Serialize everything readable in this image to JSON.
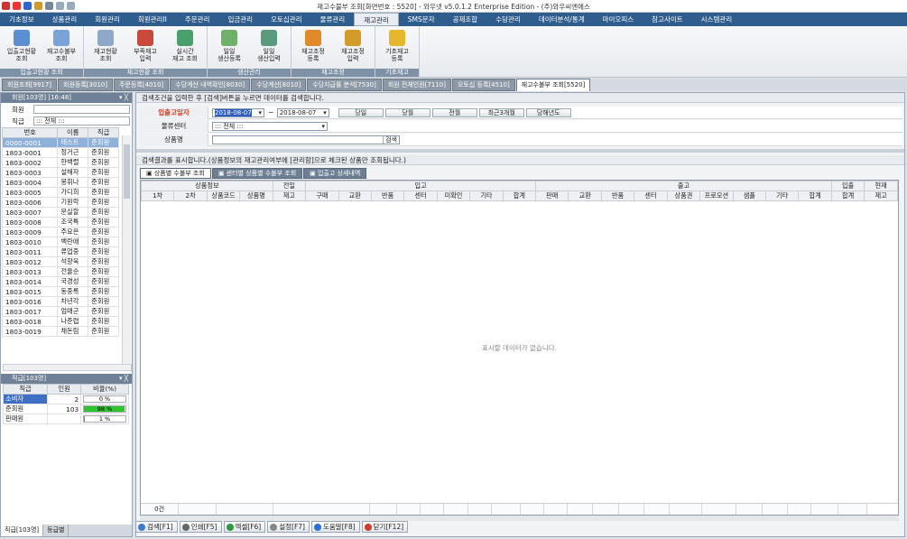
{
  "title": "재고수불부 조회[화면번호 : 5520] - 와우넷 v5.0.1.2 Enterprise Edition - (주)와우씨엔에스",
  "menu": [
    "기초정보",
    "상품관리",
    "회원관리",
    "회원관리II",
    "주문관리",
    "입금관리",
    "오토십관리",
    "물류관리",
    "재고관리",
    "SMS문자",
    "공제조합",
    "수당관리",
    "데이터분석/통계",
    "마이오피스",
    "참고사이트",
    "시스템관리"
  ],
  "active_menu": "재고관리",
  "ribbon_groups": [
    {
      "label": "입출고현황 조회",
      "buttons": [
        "입출고현황\n조회",
        "재고수불부\n조회"
      ]
    },
    {
      "label": "재고현황 조회",
      "buttons": [
        "재고현황\n조회",
        "부족재고\n입력",
        "실시간\n재고 조회"
      ]
    },
    {
      "label": "생산관리",
      "buttons": [
        "일일\n생산등록",
        "일일\n생산입력"
      ]
    },
    {
      "label": "재고조정",
      "buttons": [
        "재고조정\n등록",
        "재고조정\n입력"
      ]
    },
    {
      "label": "기초재고",
      "buttons": [
        "기초재고\n등록"
      ]
    }
  ],
  "doc_tabs": [
    "회원조회[9917]",
    "회원등록[3010]",
    "주문등록[4010]",
    "수당계산 내역확인[8030]",
    "수당계산[8010]",
    "수당지급률 분석[7530]",
    "회원 전체인원[7110]",
    "오토십 등록[4510]",
    "재고수불부 조회[5520]"
  ],
  "active_doc_tab": "재고수불부 조회[5520]",
  "left": {
    "title": "회원[103명] [16:48]",
    "filter_name_label": "회원",
    "filter_name_value": "",
    "filter_rank_label": "직급",
    "filter_rank_value": "::: 전체 :::",
    "headers": [
      "번호",
      "이름",
      "직급"
    ],
    "rows": [
      [
        "0000-0001",
        "테스트",
        "준회원"
      ],
      [
        "1803-0001",
        "정거근",
        "준회원"
      ],
      [
        "1803-0002",
        "한백렬",
        "준회원"
      ],
      [
        "1803-0003",
        "설해자",
        "준회원"
      ],
      [
        "1803-0004",
        "봉휘나",
        "준회원"
      ],
      [
        "1803-0005",
        "가디희",
        "준회원"
      ],
      [
        "1803-0006",
        "기원락",
        "준회원"
      ],
      [
        "1803-0007",
        "문실할",
        "준회원"
      ],
      [
        "1803-0008",
        "조국특",
        "준회원"
      ],
      [
        "1803-0009",
        "주요은",
        "준회원"
      ],
      [
        "1803-0010",
        "백란애",
        "준회원"
      ],
      [
        "1803-0011",
        "류업중",
        "준회원"
      ],
      [
        "1803-0012",
        "석향욱",
        "준회원"
      ],
      [
        "1803-0013",
        "전율순",
        "준회원"
      ],
      [
        "1803-0014",
        "국경성",
        "준회원"
      ],
      [
        "1803-0015",
        "동중록",
        "준회원"
      ],
      [
        "1803-0016",
        "차년각",
        "준회원"
      ],
      [
        "1803-0017",
        "엄매군",
        "준회원"
      ],
      [
        "1803-0018",
        "나준렵",
        "준회원"
      ],
      [
        "1803-0019",
        "채돈림",
        "준회원"
      ]
    ],
    "rank_title": "직급[103명]",
    "rank_headers": [
      "직급",
      "인원",
      "비율(%)"
    ],
    "rank_rows": [
      {
        "rank": "소비자",
        "count": "2",
        "pct_label": "0 %",
        "pct": 0
      },
      {
        "rank": "준회원",
        "count": "103",
        "pct_label": "98 %",
        "pct": 98
      },
      {
        "rank": "판매원",
        "count": "",
        "pct_label": "1 %",
        "pct": 1
      }
    ],
    "bottom_tabs": [
      "직급[103명]",
      "등급별"
    ]
  },
  "search": {
    "hint": "검색조건을 입력한 후 [검색]버튼을 누르면 데이터를 검색합니다.",
    "date_label": "입출고일자",
    "date_from": "2018-08-07",
    "date_to": "2018-08-07",
    "tilde": "~",
    "quick": [
      "당일",
      "당월",
      "전월",
      "최근3개월",
      "당해년도"
    ],
    "center_label": "물류센터",
    "center_value": "::: 전체 :::",
    "product_label": "상품명",
    "product_value": "",
    "search_btn": "검색"
  },
  "result": {
    "hint": "검색결과를 표시합니다.(상품정보의 재고관리여부에 [관리함]으로 체크된 상품만 조회됩니다.)",
    "tabs": [
      "상품별 수불부 조회",
      "센터별 상품별 수불부 조회",
      "입출고 상세내역"
    ],
    "group_headers": [
      "상품정보",
      "전일",
      "입고",
      "출고",
      "입출",
      "현재"
    ],
    "sub_headers": [
      "1차",
      "2차",
      "상품코드",
      "상품명",
      "재고",
      "구매",
      "교환",
      "반품",
      "센터",
      "미확인",
      "기타",
      "합계",
      "판매",
      "교환",
      "반품",
      "센터",
      "상품권",
      "프로모션",
      "샘플",
      "기타",
      "합계",
      "합계",
      "재고"
    ],
    "empty": "표시할 데이터가 없습니다.",
    "count": "0건"
  },
  "bottom_buttons": [
    {
      "label": "검색[F1]",
      "color": "#3a7bd5"
    },
    {
      "label": "인쇄[F5]",
      "color": "#666666"
    },
    {
      "label": "엑셀[F6]",
      "color": "#2e9a3e"
    },
    {
      "label": "설정[F7]",
      "color": "#888888"
    },
    {
      "label": "도움말[F8]",
      "color": "#2f6fd0"
    },
    {
      "label": "닫기[F12]",
      "color": "#d23a2a"
    }
  ]
}
